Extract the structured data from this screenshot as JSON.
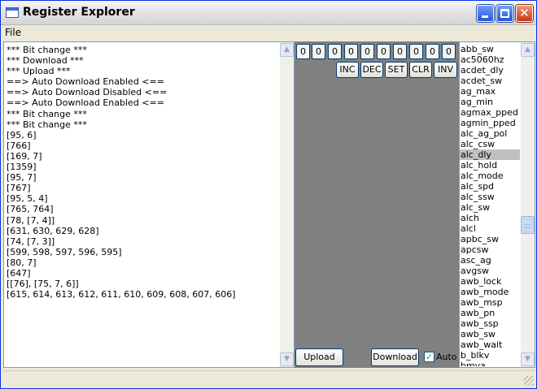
{
  "window": {
    "title": "Register Explorer"
  },
  "menu": {
    "file": "File"
  },
  "log": {
    "lines": [
      "*** Bit change ***",
      "*** Download ***",
      "*** Upload ***",
      "==> Auto Download Enabled <==",
      "==> Auto Download Disabled <==",
      "==> Auto Download Enabled <==",
      "*** Bit change ***",
      "*** Bit change ***",
      "[95, 6]",
      "[766]",
      "[169, 7]",
      "[1359]",
      "[95, 7]",
      "[767]",
      "[95, 5, 4]",
      "[765, 764]",
      "[78, [7, 4]]",
      "[631, 630, 629, 628]",
      "[74, [7, 3]]",
      "[599, 598, 597, 596, 595]",
      "[80, 7]",
      "[647]",
      "[[76], [75, 7, 6]]",
      "[615, 614, 613, 612, 611, 610, 609, 608, 607, 606]"
    ]
  },
  "bits": [
    "0",
    "0",
    "0",
    "0",
    "0",
    "0",
    "0",
    "0",
    "0",
    "0"
  ],
  "ops": {
    "inc": "INC",
    "dec": "DEC",
    "set": "SET",
    "clr": "CLR",
    "inv": "INV"
  },
  "actions": {
    "upload": "Upload",
    "download": "Download",
    "auto_label": "Auto",
    "auto_checked": true
  },
  "registers": {
    "selected": "alc_dly",
    "items": [
      "abb_sw",
      "ac5060hz",
      "acdet_dly",
      "acdet_sw",
      "ag_max",
      "ag_min",
      "agmax_pped",
      "agmin_pped",
      "alc_ag_pol",
      "alc_csw",
      "alc_dly",
      "alc_hold",
      "alc_mode",
      "alc_spd",
      "alc_ssw",
      "alc_sw",
      "alch",
      "alcl",
      "apbc_sw",
      "apcsw",
      "asc_ag",
      "avgsw",
      "awb_lock",
      "awb_mode",
      "awb_msp",
      "awb_pn",
      "awb_ssp",
      "awb_sw",
      "awb_wait",
      "b_blkv",
      "bmva"
    ]
  }
}
